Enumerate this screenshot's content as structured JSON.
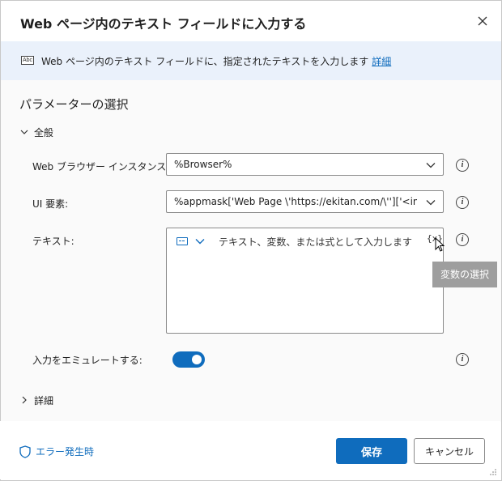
{
  "dialog": {
    "title": "Web ページ内のテキスト フィールドに入力する",
    "close_icon": "close-icon"
  },
  "banner": {
    "icon": "abc-text-icon",
    "icon_text": "Abc",
    "text": "Web ページ内のテキスト フィールドに、指定されたテキストを入力します",
    "link": "詳細"
  },
  "parameters": {
    "title": "パラメーターの選択",
    "general_group": "全般",
    "details_group": "詳細"
  },
  "fields": {
    "browser_label": "Web ブラウザー インスタンス:",
    "browser_value": "%Browser%",
    "ui_label": "UI 要素:",
    "ui_value": "%appmask['Web Page \\'https://ekitan.com/\\'']['<input:te",
    "text_label": "テキスト:",
    "text_placeholder": "テキスト、変数、または式として入力します",
    "var_button": "{x}",
    "emulate_label": "入力をエミュレートする:",
    "emulate_on": true,
    "info_icon": "i"
  },
  "tooltip": {
    "text": "変数の選択"
  },
  "footer": {
    "error_link": "エラー発生時",
    "save_button": "保存",
    "cancel_button": "キャンセル"
  },
  "colors": {
    "accent": "#0f6cbd",
    "banner_bg": "#eaf1fb",
    "tooltip_bg": "#9e9e9e"
  }
}
